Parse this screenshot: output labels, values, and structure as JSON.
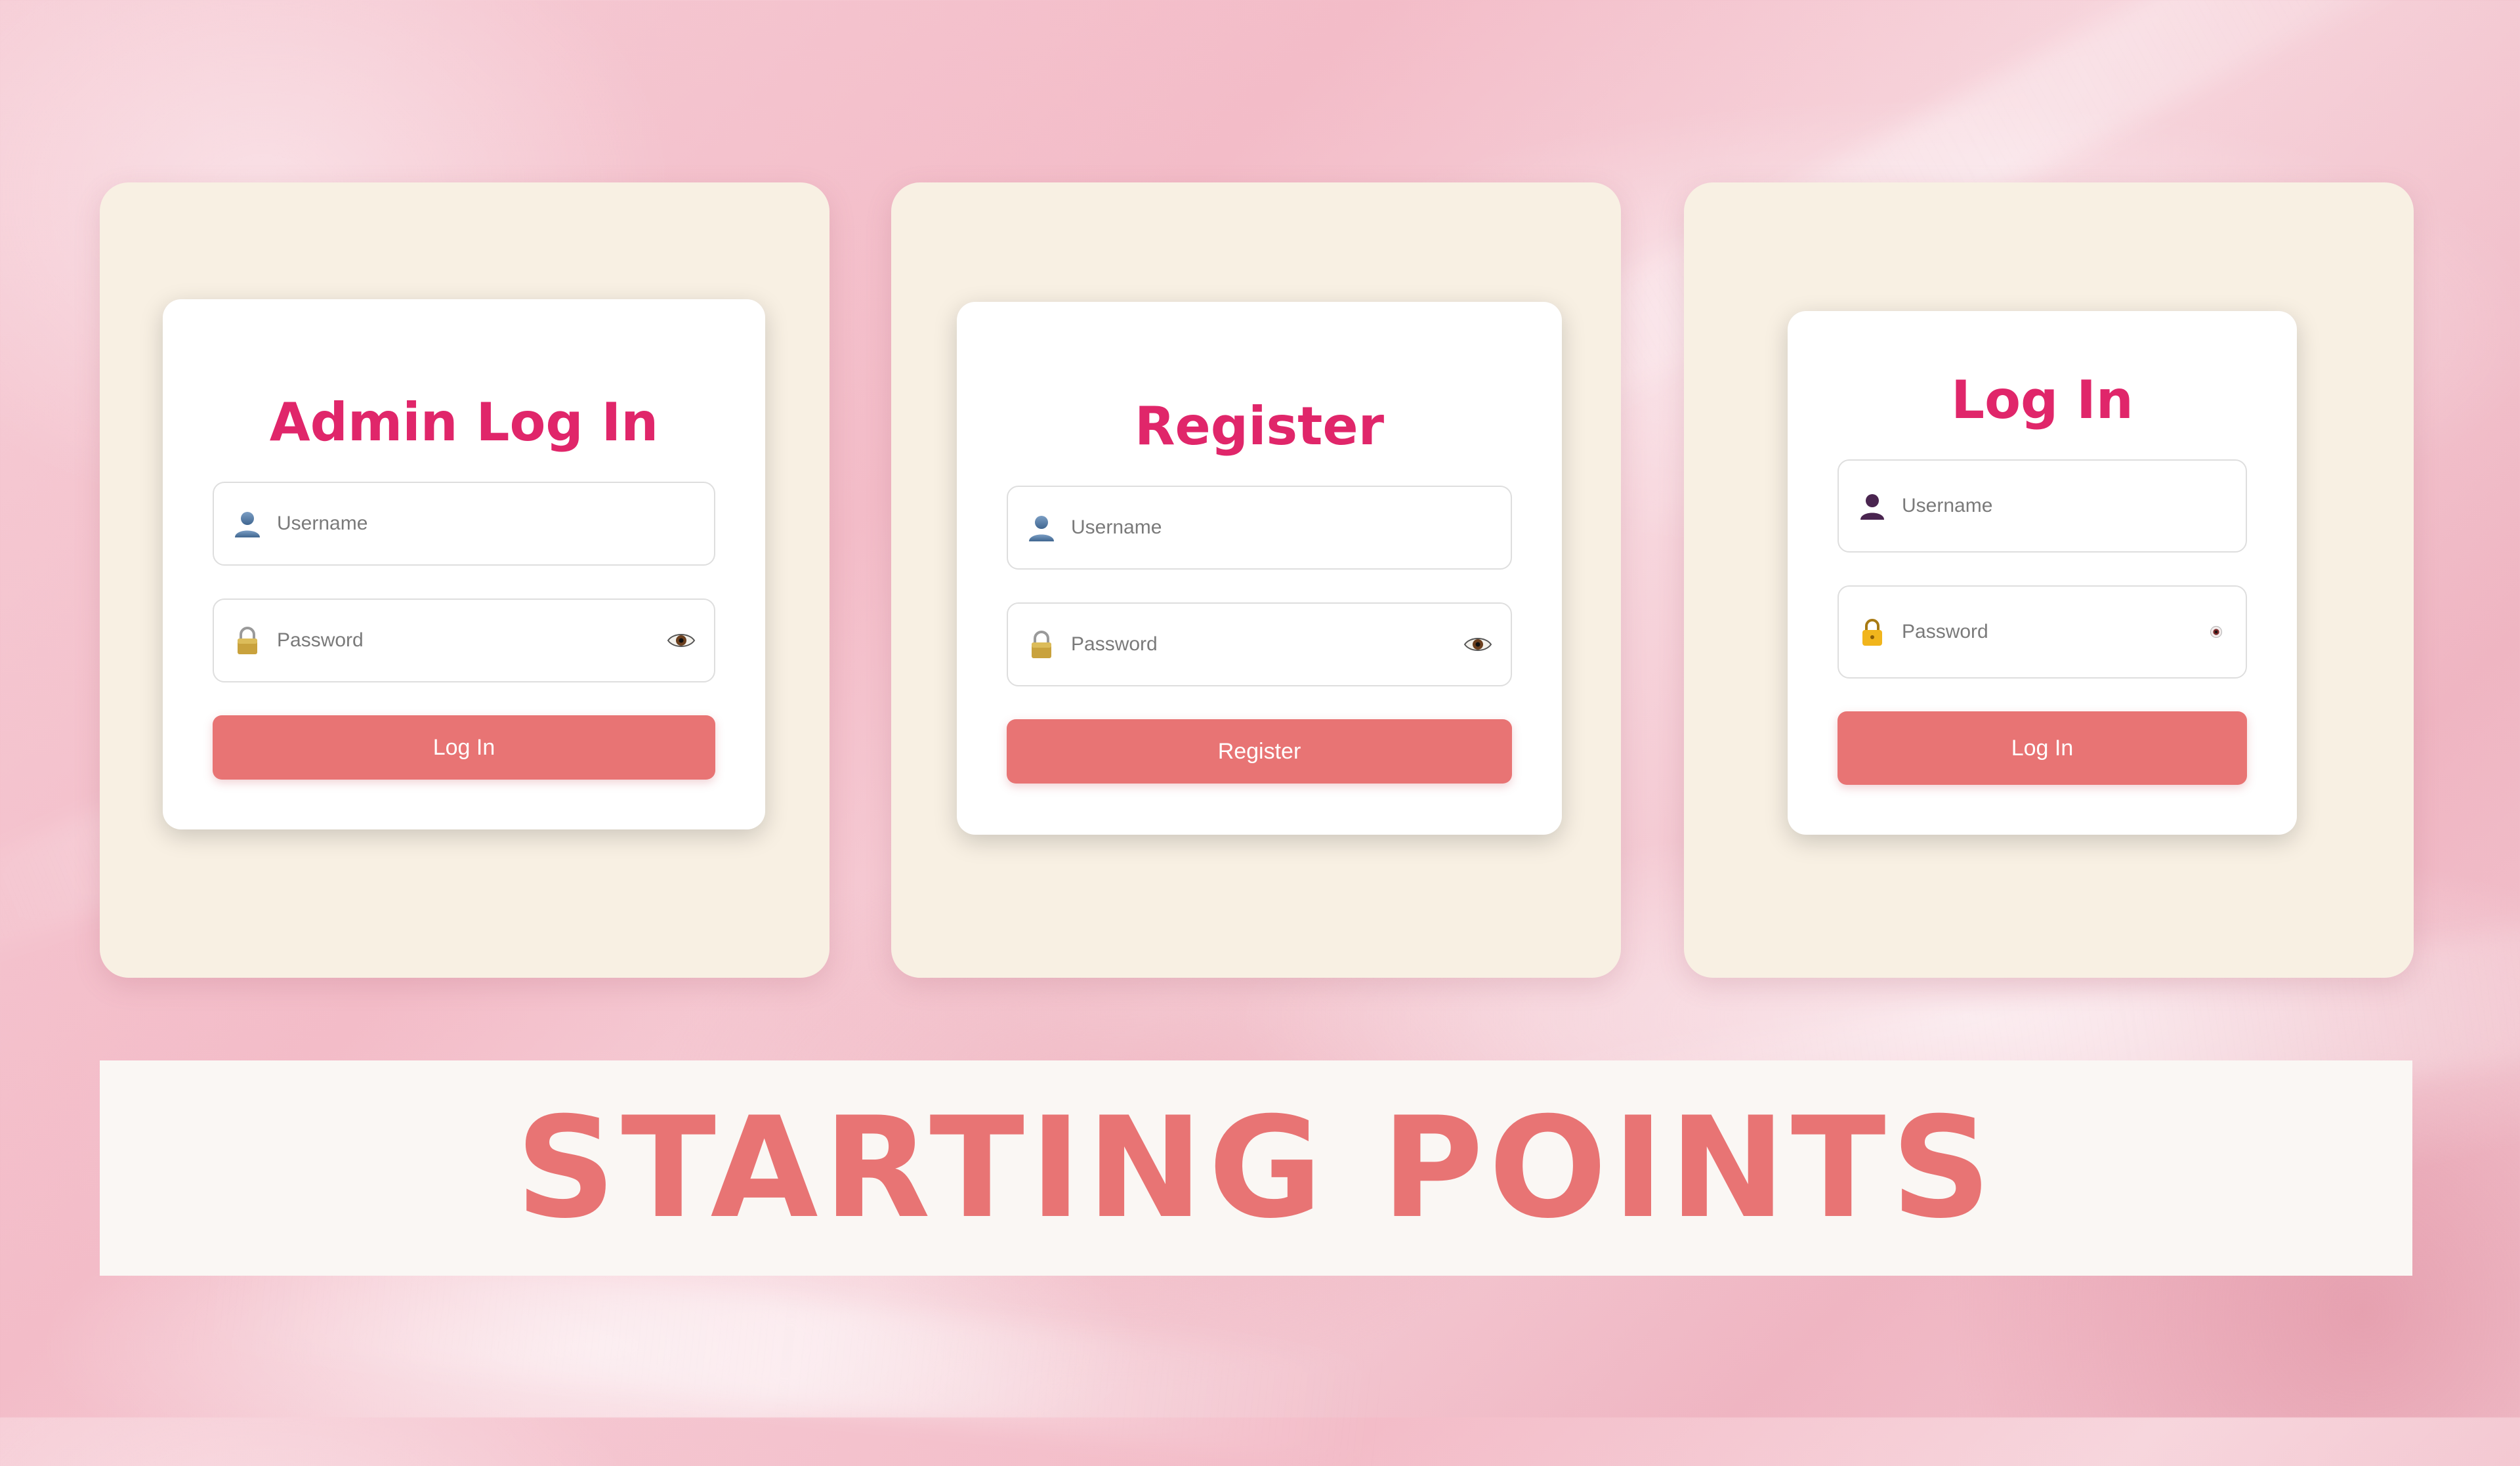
{
  "colors": {
    "title": "#e0266a",
    "button": "#e87474",
    "banner_text": "#e87474",
    "panel": "#f8f0e3",
    "banner_bg": "#faf7f4"
  },
  "cards": [
    {
      "title": "Admin Log In",
      "username_placeholder": "Username",
      "password_placeholder": "Password",
      "username_icon": "user-icon",
      "password_icon": "padlock-icon",
      "reveal_icon": "eye-icon",
      "button_label": "Log In"
    },
    {
      "title": "Register",
      "username_placeholder": "Username",
      "password_placeholder": "Password",
      "username_icon": "user-icon",
      "password_icon": "padlock-icon",
      "reveal_icon": "eye-icon",
      "button_label": "Register"
    },
    {
      "title": "Log In",
      "username_placeholder": "Username",
      "password_placeholder": "Password",
      "username_icon": "user-icon",
      "password_icon": "lock-icon",
      "reveal_icon": "eye-icon",
      "button_label": "Log In"
    }
  ],
  "banner": {
    "text": "STARTING POINTS"
  }
}
